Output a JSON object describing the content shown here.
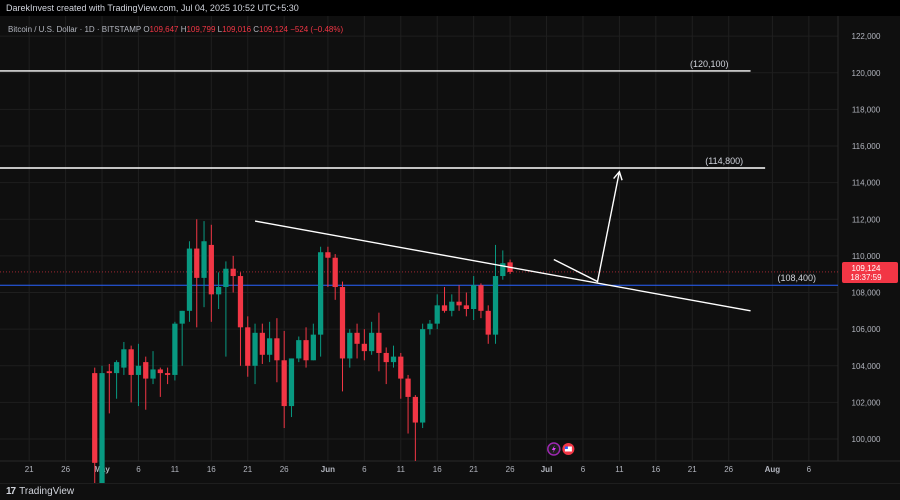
{
  "header": {
    "credit": "DarekInvest created with TradingView.com, Jul 04, 2025 10:52 UTC+5:30"
  },
  "footer": {
    "brand": "TradingView"
  },
  "chart_data": {
    "type": "candlestick",
    "legend": {
      "symbol": "Bitcoin / U.S. Dollar · 1D · BITSTAMP",
      "o_label": "O",
      "o": "109,647",
      "h_label": "H",
      "h": "109,799",
      "l_label": "L",
      "l": "109,016",
      "c_label": "C",
      "c": "109,124",
      "change": "−524 (−0.48%)"
    },
    "y_ticks": [
      100000,
      102000,
      104000,
      106000,
      108000,
      110000,
      112000,
      114000,
      116000,
      118000,
      120000,
      122000
    ],
    "y_tick_labels": [
      "100,000",
      "102,000",
      "104,000",
      "106,000",
      "108,000",
      "110,000",
      "112,000",
      "114,000",
      "116,000",
      "118,000",
      "120,000",
      "122,000"
    ],
    "ylim": [
      98800,
      123100
    ],
    "x_range": [
      "2025-04-17",
      "2025-08-10"
    ],
    "x_ticks": [
      {
        "date": "2025-04-21",
        "label": "21",
        "bold": false
      },
      {
        "date": "2025-04-26",
        "label": "26",
        "bold": false
      },
      {
        "date": "2025-05-01",
        "label": "May",
        "bold": true
      },
      {
        "date": "2025-05-06",
        "label": "6",
        "bold": false
      },
      {
        "date": "2025-05-11",
        "label": "11",
        "bold": false
      },
      {
        "date": "2025-05-16",
        "label": "16",
        "bold": false
      },
      {
        "date": "2025-05-21",
        "label": "21",
        "bold": false
      },
      {
        "date": "2025-05-26",
        "label": "26",
        "bold": false
      },
      {
        "date": "2025-06-01",
        "label": "Jun",
        "bold": true
      },
      {
        "date": "2025-06-06",
        "label": "6",
        "bold": false
      },
      {
        "date": "2025-06-11",
        "label": "11",
        "bold": false
      },
      {
        "date": "2025-06-16",
        "label": "16",
        "bold": false
      },
      {
        "date": "2025-06-21",
        "label": "21",
        "bold": false
      },
      {
        "date": "2025-06-26",
        "label": "26",
        "bold": false
      },
      {
        "date": "2025-07-01",
        "label": "Jul",
        "bold": true
      },
      {
        "date": "2025-07-06",
        "label": "6",
        "bold": false
      },
      {
        "date": "2025-07-11",
        "label": "11",
        "bold": false
      },
      {
        "date": "2025-07-16",
        "label": "16",
        "bold": false
      },
      {
        "date": "2025-07-21",
        "label": "21",
        "bold": false
      },
      {
        "date": "2025-07-26",
        "label": "26",
        "bold": false
      },
      {
        "date": "2025-08-01",
        "label": "Aug",
        "bold": true
      },
      {
        "date": "2025-08-06",
        "label": "6",
        "bold": false
      }
    ],
    "first_candle_date": "2025-04-30",
    "candles": [
      [
        103600,
        103900,
        96400,
        98700
      ],
      [
        97000,
        104000,
        96900,
        103600
      ],
      [
        103700,
        104100,
        101400,
        103600
      ],
      [
        103600,
        104300,
        102200,
        104200
      ],
      [
        103900,
        105300,
        103500,
        104900
      ],
      [
        104900,
        105100,
        102000,
        103500
      ],
      [
        103500,
        105200,
        101800,
        104000
      ],
      [
        104200,
        104500,
        101600,
        103300
      ],
      [
        103300,
        104800,
        103000,
        103800
      ],
      [
        103800,
        103900,
        102300,
        103600
      ],
      [
        103600,
        103900,
        103000,
        103500
      ],
      [
        103500,
        106400,
        103200,
        106300
      ],
      [
        106300,
        107000,
        104000,
        107000
      ],
      [
        107000,
        110800,
        106400,
        110400
      ],
      [
        110400,
        112000,
        106100,
        108800
      ],
      [
        108800,
        111900,
        107200,
        110800
      ],
      [
        110600,
        111700,
        106400,
        107900
      ],
      [
        107900,
        109100,
        107100,
        108300
      ],
      [
        108300,
        109700,
        104500,
        109300
      ],
      [
        109300,
        110000,
        108000,
        108900
      ],
      [
        108900,
        109100,
        104000,
        106100
      ],
      [
        106100,
        106700,
        103400,
        104000
      ],
      [
        104000,
        106300,
        103000,
        105800
      ],
      [
        105800,
        106300,
        104100,
        104600
      ],
      [
        104600,
        106400,
        104200,
        105500
      ],
      [
        105500,
        106600,
        103100,
        104300
      ],
      [
        104300,
        105900,
        100600,
        101800
      ],
      [
        101800,
        104400,
        101200,
        104400
      ],
      [
        104400,
        105600,
        104200,
        105400
      ],
      [
        105400,
        106100,
        103900,
        104300
      ],
      [
        104300,
        106300,
        104300,
        105700
      ],
      [
        105700,
        110500,
        104500,
        110200
      ],
      [
        110200,
        110500,
        108300,
        109900
      ],
      [
        109900,
        110100,
        107600,
        108300
      ],
      [
        108300,
        108600,
        102600,
        104400
      ],
      [
        104400,
        106000,
        103900,
        105800
      ],
      [
        105800,
        106300,
        104400,
        105200
      ],
      [
        105200,
        106000,
        104300,
        104800
      ],
      [
        104800,
        106400,
        104600,
        105800
      ],
      [
        105800,
        106900,
        103700,
        104700
      ],
      [
        104700,
        105000,
        103000,
        104200
      ],
      [
        104200,
        105100,
        103900,
        104500
      ],
      [
        104500,
        104700,
        102200,
        103300
      ],
      [
        103300,
        103500,
        100300,
        102300
      ],
      [
        102300,
        102400,
        98800,
        100900
      ],
      [
        100900,
        106300,
        100600,
        106000
      ],
      [
        106000,
        106500,
        105700,
        106300
      ],
      [
        106300,
        107900,
        106000,
        107300
      ],
      [
        107300,
        108300,
        106900,
        107000
      ],
      [
        107000,
        107900,
        106700,
        107500
      ],
      [
        107500,
        108400,
        107000,
        107300
      ],
      [
        107300,
        108000,
        106700,
        107100
      ],
      [
        107100,
        108900,
        106500,
        108400
      ],
      [
        108400,
        108500,
        106600,
        107000
      ],
      [
        107000,
        107300,
        105200,
        105700
      ],
      [
        105700,
        110600,
        105200,
        108900
      ],
      [
        108900,
        110300,
        108700,
        109600
      ],
      [
        109647,
        109799,
        109016,
        109124
      ]
    ],
    "current_price": 109124,
    "price_label": "109,124",
    "countdown": "18:37:59",
    "levels": [
      {
        "value": 120100,
        "label": "(120,100)",
        "color": "#ffffff",
        "start": "2025-04-17",
        "end": "2025-07-29"
      },
      {
        "value": 114800,
        "label": "(114,800)",
        "color": "#ffffff",
        "start": "2025-04-17",
        "end": "2025-07-31"
      },
      {
        "value": 108400,
        "label": "(108,400)",
        "color": "#2962ff",
        "start": "2025-04-17",
        "end": "2025-08-10"
      }
    ],
    "trendline": {
      "from": {
        "date": "2025-05-22",
        "value": 111900
      },
      "to": {
        "date": "2025-07-29",
        "value": 107000
      }
    },
    "projection": [
      {
        "date": "2025-07-02",
        "value": 109800
      },
      {
        "date": "2025-07-08",
        "value": 108600
      },
      {
        "date": "2025-07-11",
        "value": 114600
      }
    ],
    "event_markers": [
      {
        "date": "2025-07-02",
        "icon": "lightning-icon"
      },
      {
        "date": "2025-07-04",
        "icon": "flag-icon"
      }
    ],
    "colors": {
      "up": "#089981",
      "down": "#f23645",
      "grid": "#1f1f1f",
      "text": "#b2b5be",
      "level_line": "#ffffff",
      "support": "#2962ff"
    }
  }
}
